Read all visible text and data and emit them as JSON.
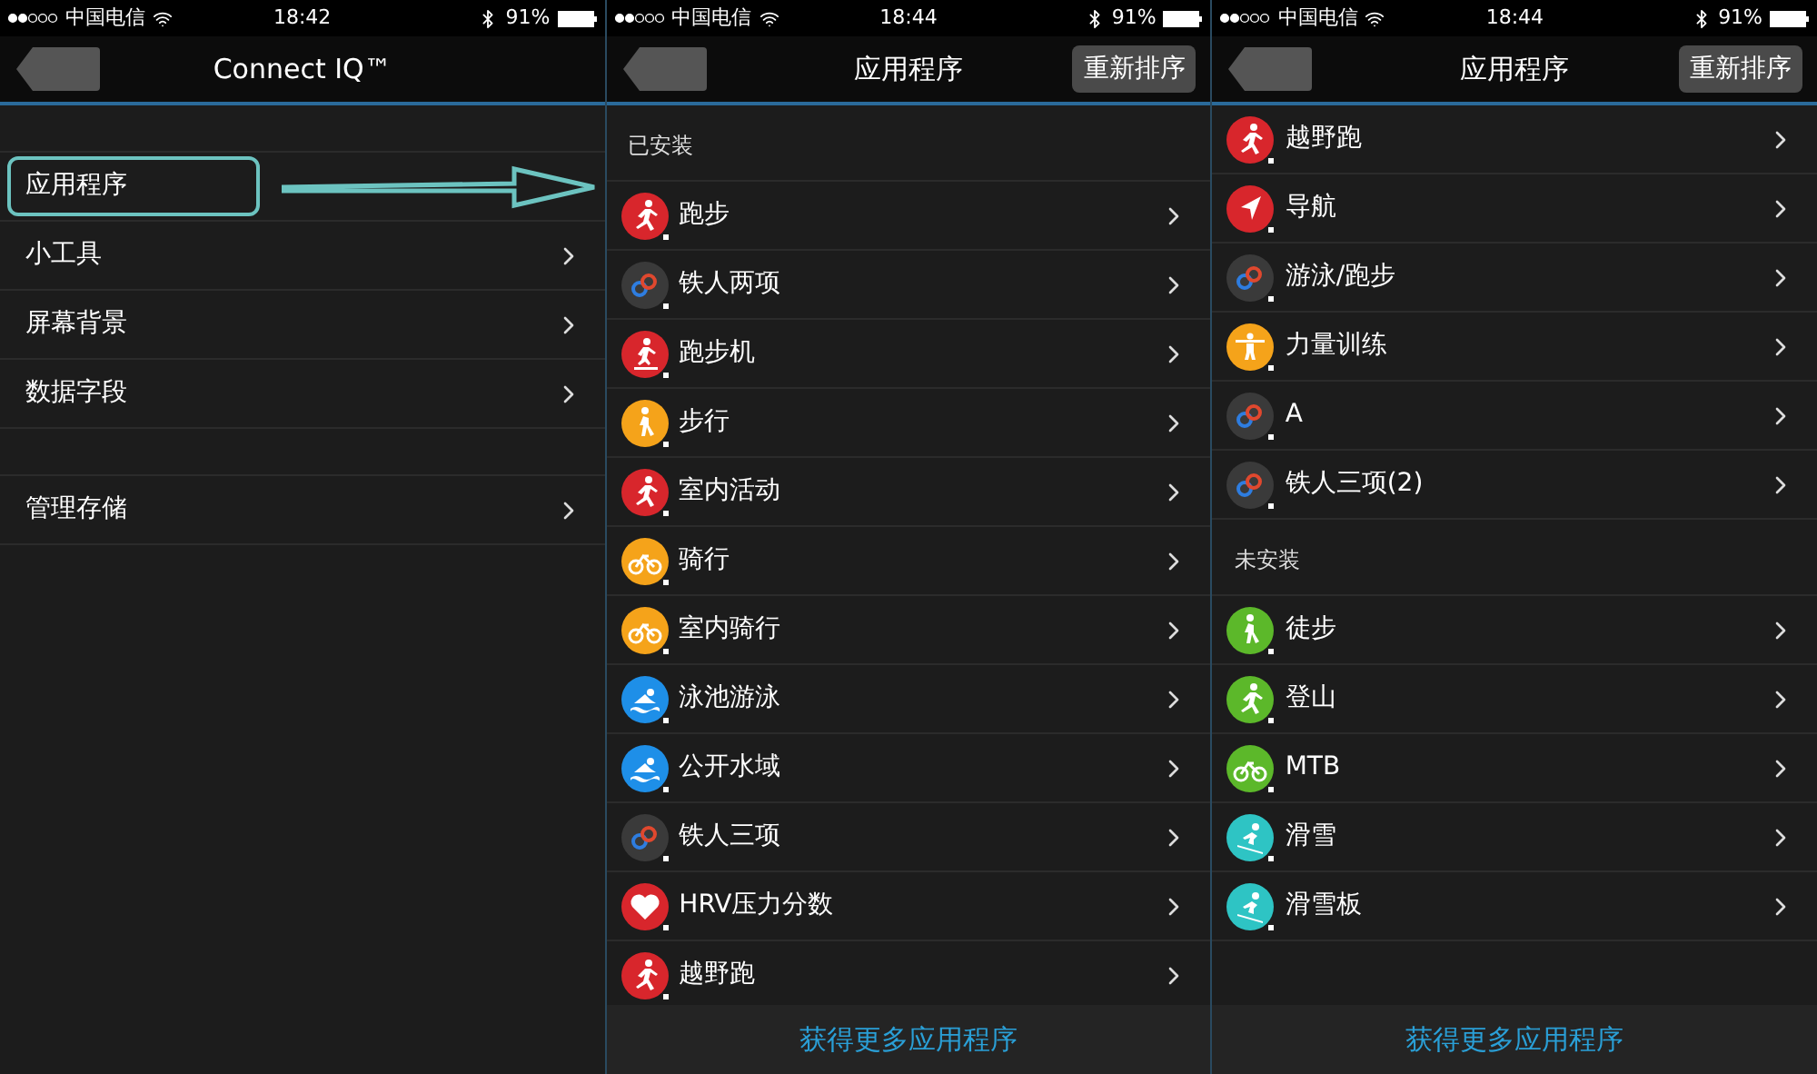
{
  "screens": [
    {
      "status": {
        "carrier": "中国电信",
        "time": "18:42",
        "battery": "91%"
      },
      "nav": {
        "title": "Connect IQ™"
      },
      "sections": [
        {
          "kind": "group",
          "items": [
            {
              "label": "应用程序",
              "highlighted": true
            },
            {
              "label": "小工具",
              "highlighted": false
            },
            {
              "label": "屏幕背景",
              "highlighted": false
            },
            {
              "label": "数据字段",
              "highlighted": false
            }
          ]
        },
        {
          "kind": "group",
          "items": [
            {
              "label": "管理存储",
              "highlighted": false
            }
          ]
        }
      ]
    },
    {
      "status": {
        "carrier": "中国电信",
        "time": "18:44",
        "battery": "91%"
      },
      "nav": {
        "title": "应用程序",
        "action": "重新排序"
      },
      "sections": [
        {
          "kind": "titled",
          "heading": "已安装",
          "items": [
            {
              "label": "跑步",
              "icon": {
                "kind": "run",
                "color": "#d8262c"
              }
            },
            {
              "label": "铁人两项",
              "icon": {
                "kind": "rings",
                "color": "#3a3a3a"
              }
            },
            {
              "label": "跑步机",
              "icon": {
                "kind": "treadmill",
                "color": "#d8262c"
              }
            },
            {
              "label": "步行",
              "icon": {
                "kind": "walk",
                "color": "#f5a31a"
              }
            },
            {
              "label": "室内活动",
              "icon": {
                "kind": "run",
                "color": "#d8262c"
              }
            },
            {
              "label": "骑行",
              "icon": {
                "kind": "bike",
                "color": "#f5a31a"
              }
            },
            {
              "label": "室内骑行",
              "icon": {
                "kind": "bike",
                "color": "#f5a31a"
              }
            },
            {
              "label": "泳池游泳",
              "icon": {
                "kind": "swim",
                "color": "#1e8fe8"
              }
            },
            {
              "label": "公开水域",
              "icon": {
                "kind": "swim",
                "color": "#1e8fe8"
              }
            },
            {
              "label": "铁人三项",
              "icon": {
                "kind": "rings",
                "color": "#3a3a3a"
              }
            },
            {
              "label": "HRV压力分数",
              "icon": {
                "kind": "heart",
                "color": "#d8262c"
              }
            },
            {
              "label": "越野跑",
              "icon": {
                "kind": "run",
                "color": "#d8262c"
              }
            }
          ]
        }
      ],
      "footer": "获得更多应用程序"
    },
    {
      "status": {
        "carrier": "中国电信",
        "time": "18:44",
        "battery": "91%"
      },
      "nav": {
        "title": "应用程序",
        "action": "重新排序"
      },
      "sections": [
        {
          "kind": "continued",
          "items": [
            {
              "label": "越野跑",
              "icon": {
                "kind": "run",
                "color": "#d8262c"
              }
            },
            {
              "label": "导航",
              "icon": {
                "kind": "nav",
                "color": "#d8262c"
              }
            },
            {
              "label": "游泳/跑步",
              "icon": {
                "kind": "rings",
                "color": "#3a3a3a"
              }
            },
            {
              "label": "力量训练",
              "icon": {
                "kind": "strength",
                "color": "#f5a31a"
              }
            },
            {
              "label": "A",
              "icon": {
                "kind": "rings",
                "color": "#3a3a3a"
              }
            },
            {
              "label": "铁人三项(2)",
              "icon": {
                "kind": "rings",
                "color": "#3a3a3a"
              }
            }
          ]
        },
        {
          "kind": "titled",
          "heading": "未安装",
          "items": [
            {
              "label": "徒步",
              "icon": {
                "kind": "walk",
                "color": "#5cb82a"
              }
            },
            {
              "label": "登山",
              "icon": {
                "kind": "run",
                "color": "#5cb82a"
              }
            },
            {
              "label": "MTB",
              "icon": {
                "kind": "bike",
                "color": "#5cb82a"
              }
            },
            {
              "label": "滑雪",
              "icon": {
                "kind": "ski",
                "color": "#2ec4c4"
              }
            },
            {
              "label": "滑雪板",
              "icon": {
                "kind": "ski",
                "color": "#2ec4c4"
              }
            }
          ]
        }
      ],
      "footer": "获得更多应用程序"
    }
  ]
}
